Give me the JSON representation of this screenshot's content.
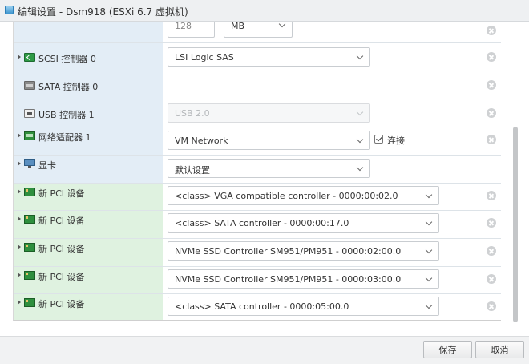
{
  "window": {
    "title": "编辑设置 - Dsm918 (ESXi 6.7 虚拟机)"
  },
  "memory_row": {
    "value": "128",
    "unit": "MB"
  },
  "devices": [
    {
      "label": "SCSI 控制器 0",
      "icon": "scsi-controller-icon",
      "expandable": true,
      "value": "LSI Logic SAS",
      "control": "select"
    },
    {
      "label": "SATA 控制器 0",
      "icon": "sata-controller-icon",
      "expandable": false,
      "value": "",
      "control": "none"
    },
    {
      "label": "USB 控制器 1",
      "icon": "usb-controller-icon",
      "expandable": false,
      "value": "USB 2.0",
      "control": "select-disabled"
    },
    {
      "label": "网络适配器 1",
      "icon": "network-adapter-icon",
      "expandable": true,
      "value": "VM Network",
      "control": "select",
      "connect_label": "连接",
      "connected": true
    },
    {
      "label": "显卡",
      "icon": "video-card-icon",
      "expandable": true,
      "value": "默认设置",
      "control": "select"
    },
    {
      "label": "新 PCI 设备",
      "icon": "pci-device-icon",
      "expandable": true,
      "value": "<class> VGA compatible controller - 0000:00:02.0",
      "control": "select-wide"
    },
    {
      "label": "新 PCI 设备",
      "icon": "pci-device-icon",
      "expandable": true,
      "value": "<class> SATA controller - 0000:00:17.0",
      "control": "select-wide"
    },
    {
      "label": "新 PCI 设备",
      "icon": "pci-device-icon",
      "expandable": true,
      "value": "NVMe SSD Controller SM951/PM951 - 0000:02:00.0",
      "control": "select-wide"
    },
    {
      "label": "新 PCI 设备",
      "icon": "pci-device-icon",
      "expandable": true,
      "value": "NVMe SSD Controller SM951/PM951 - 0000:03:00.0",
      "control": "select-wide"
    },
    {
      "label": "新 PCI 设备",
      "icon": "pci-device-icon",
      "expandable": true,
      "value": "<class> SATA controller - 0000:05:00.0",
      "control": "select-wide"
    }
  ],
  "footer": {
    "save_label": "保存",
    "cancel_label": "取消"
  }
}
